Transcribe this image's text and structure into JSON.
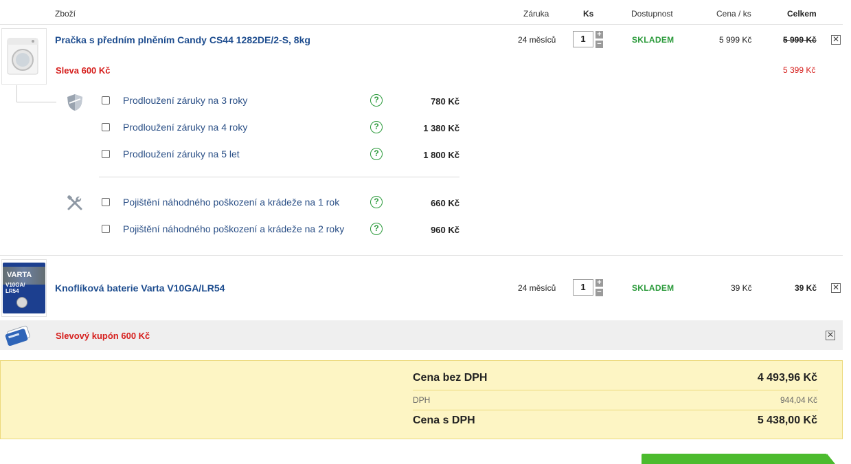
{
  "header": {
    "product": "Zboží",
    "warranty": "Záruka",
    "qty": "Ks",
    "availability": "Dostupnost",
    "unit_price": "Cena / ks",
    "total": "Celkem"
  },
  "items": [
    {
      "name": "Pračka s předním plněním Candy CS44 1282DE/2-S, 8kg",
      "warranty": "24 měsíců",
      "qty": "1",
      "availability": "SKLADEM",
      "unit_price": "5 999 Kč",
      "total_old": "5 999 Kč",
      "discount_label": "Sleva 600 Kč",
      "total_new": "5 399 Kč"
    },
    {
      "name": "Knoflíková baterie Varta V10GA/LR54",
      "warranty": "24 měsíců",
      "qty": "1",
      "availability": "SKLADEM",
      "unit_price": "39 Kč",
      "total": "39 Kč",
      "thumb_brand": "VARTA",
      "thumb_model": "V10GA/",
      "thumb_model2": "LR54"
    }
  ],
  "warranty_options": [
    {
      "label": "Prodloužení záruky na 3 roky",
      "price": "780 Kč"
    },
    {
      "label": "Prodloužení záruky na 4 roky",
      "price": "1 380 Kč"
    },
    {
      "label": "Prodloužení záruky na 5 let",
      "price": "1 800 Kč"
    }
  ],
  "insurance_options": [
    {
      "label": "Pojištění náhodného poškození a krádeže na 1 rok",
      "price": "660 Kč"
    },
    {
      "label": "Pojištění náhodného poškození a krádeže na 2 roky",
      "price": "960 Kč"
    }
  ],
  "coupon": {
    "label": "Slevový kupón 600 Kč"
  },
  "summary": {
    "net_label": "Cena bez DPH",
    "net_value": "4 493,96 Kč",
    "vat_label": "DPH",
    "vat_value": "944,04 Kč",
    "gross_label": "Cena s DPH",
    "gross_value": "5 438,00 Kč"
  },
  "icons": {
    "help": "?",
    "plus": "+",
    "minus": "−",
    "close": "✕"
  },
  "colors": {
    "link_blue": "#1e4d8f",
    "stock_green": "#2a9a3a",
    "discount_red": "#d6201e",
    "summary_bg": "#fdf5c4",
    "cta_green": "#4cbb2e"
  }
}
